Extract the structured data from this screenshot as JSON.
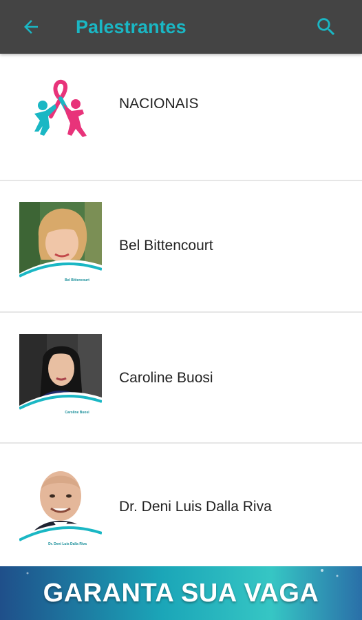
{
  "toolbar": {
    "title": "Palestrantes",
    "back_icon": "arrow-left-icon",
    "search_icon": "search-icon",
    "background": "#444444",
    "accent": "#1ab7c4"
  },
  "speakers": [
    {
      "name": "NACIONAIS",
      "thumb": "nacionais-logo"
    },
    {
      "name": "Bel Bittencourt",
      "thumb": "speaker-photo",
      "caption": "Bel Bittencourt"
    },
    {
      "name": "Caroline Buosi",
      "thumb": "speaker-photo",
      "caption": "Caroline Buosi"
    },
    {
      "name": "Dr. Deni Luis Dalla Riva",
      "thumb": "speaker-photo",
      "caption": "Dr. Deni Luis Dalla Riva"
    }
  ],
  "banner": {
    "text": "GARANTA SUA VAGA"
  }
}
